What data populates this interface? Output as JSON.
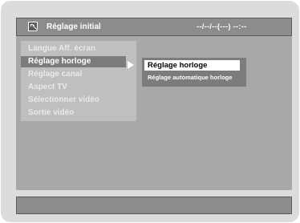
{
  "header": {
    "title": "Réglage initial",
    "datetime": "--/--/--(---)   --:--",
    "icon": "setup-wrench-icon"
  },
  "menu": {
    "items": [
      {
        "label": "Langue Aff. écran",
        "selected": false
      },
      {
        "label": "Réglage horloge",
        "selected": true
      },
      {
        "label": "Réglage canal",
        "selected": false
      },
      {
        "label": "Aspect TV",
        "selected": false
      },
      {
        "label": "Sélectionner vidéo",
        "selected": false
      },
      {
        "label": "Sortie vidéo",
        "selected": false
      }
    ]
  },
  "submenu": {
    "items": [
      {
        "label": "Réglage horloge",
        "selected": true
      },
      {
        "label": "Réglage automatique horloge",
        "selected": false
      }
    ]
  },
  "colors": {
    "background": "#dcdcdc",
    "bar": "#8c8c8c",
    "content": "#a8a8a8",
    "menu_panel": "#bfbfbf",
    "highlight": "#7c7c7c",
    "selected_item": "#ffffff"
  }
}
